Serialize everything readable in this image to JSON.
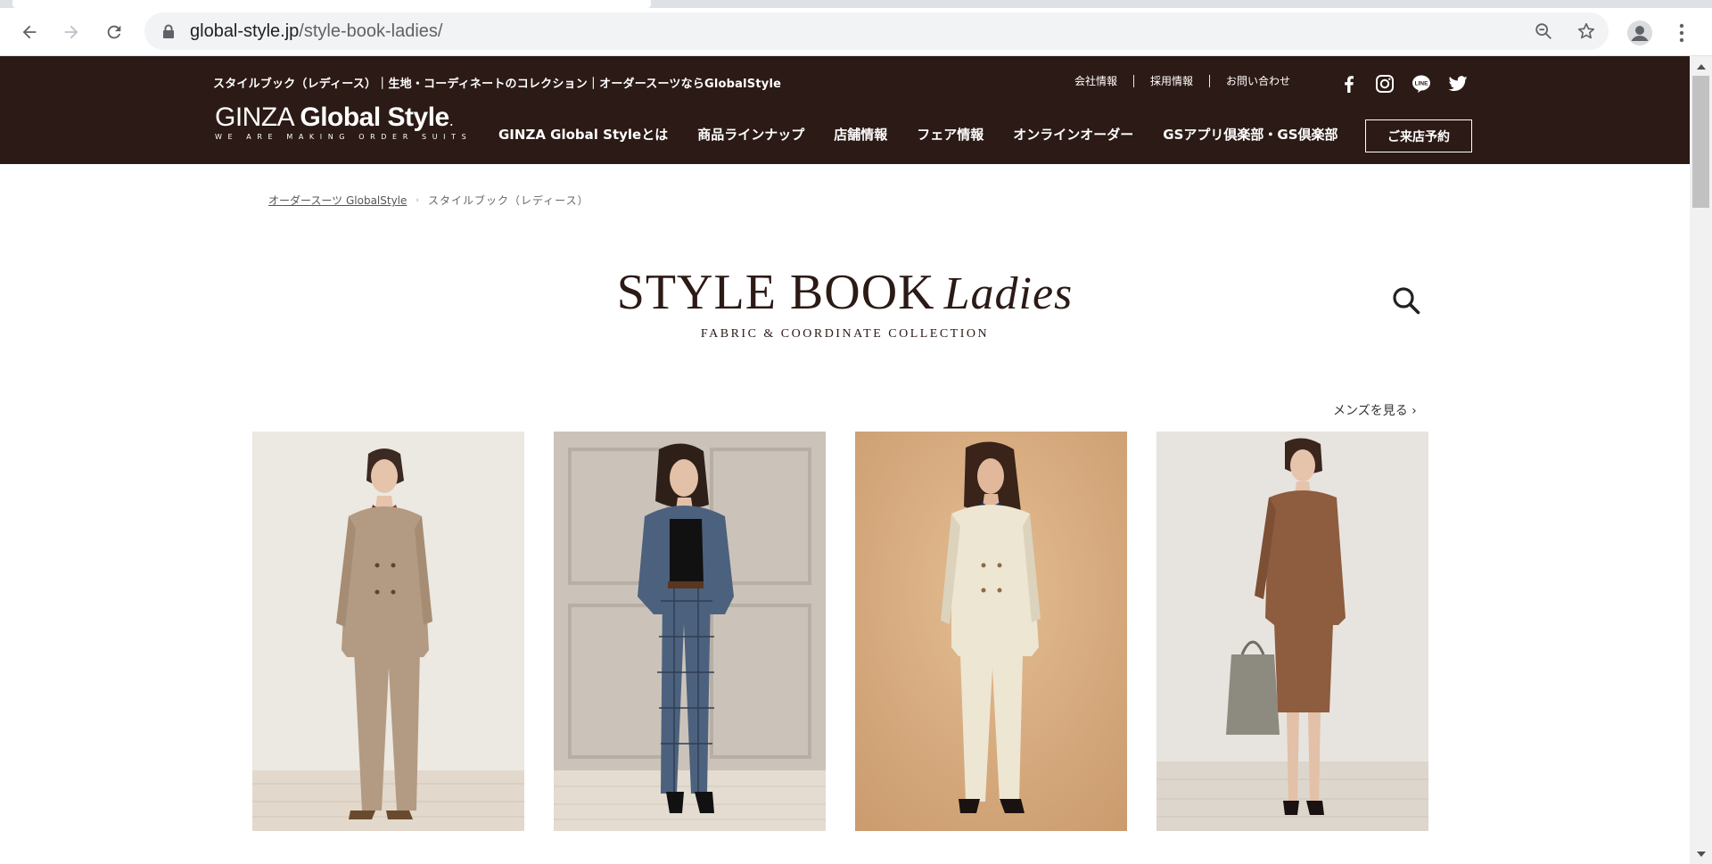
{
  "browser": {
    "url_domain": "global-style.jp",
    "url_path": "/style-book-ladies/",
    "icons": [
      "back-icon",
      "forward-icon",
      "reload-icon",
      "lock-icon",
      "zoom-icon",
      "star-icon",
      "profile-icon",
      "menu-icon"
    ]
  },
  "header": {
    "page_heading": "スタイルブック（レディース）｜生地・コーディネートのコレクション｜オーダースーツならGlobalStyle",
    "util_links": [
      "会社情報",
      "採用情報",
      "お問い合わせ"
    ],
    "social": [
      "facebook-icon",
      "instagram-icon",
      "line-icon",
      "twitter-icon"
    ],
    "logo_thin": "GINZA ",
    "logo_bold": "Global Style",
    "logo_mark": ".",
    "logo_tagline": "WE ARE MAKING ORDER SUITS",
    "nav": [
      "GINZA Global Styleとは",
      "商品ラインナップ",
      "店舗情報",
      "フェア情報",
      "オンラインオーダー",
      "GSアプリ倶楽部・GS倶楽部"
    ],
    "reserve": "ご来店予約",
    "bg_color": "#2b1a15"
  },
  "breadcrumb": {
    "home": "オーダースーツ GlobalStyle",
    "separator": "›",
    "current": "スタイルブック（レディース）"
  },
  "stylebook": {
    "title_main": "STYLE BOOK",
    "title_script": "Ladies",
    "subtitle": "FABRIC & COORDINATE COLLECTION",
    "mens_link": "メンズを見る ›"
  },
  "cards": [
    {
      "name": "beige-double-breasted-suit",
      "suit_color": "#b39a82",
      "bg_color": "#ece8e2"
    },
    {
      "name": "blue-check-suit",
      "suit_color": "#4c617d",
      "bg_color": "#cbc3ba"
    },
    {
      "name": "ivory-double-breasted-suit",
      "suit_color": "#ede6d3",
      "bg_color": "#d8ab80"
    },
    {
      "name": "brown-skirt-suit",
      "suit_color": "#8e5c3e",
      "bg_color": "#e7e4df"
    }
  ]
}
